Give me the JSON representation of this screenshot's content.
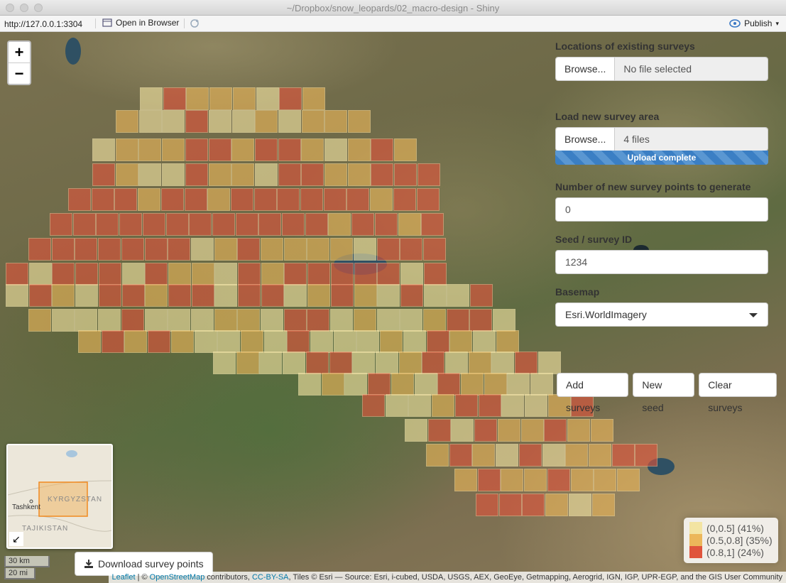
{
  "window": {
    "title": "~/Dropbox/snow_leopards/02_macro-design - Shiny"
  },
  "toolbar": {
    "url": "http://127.0.0.1:3304",
    "open_label": "Open in Browser",
    "publish_label": "Publish"
  },
  "map": {
    "zoom_in": "+",
    "zoom_out": "−",
    "minimap_labels": [
      "KYRGYZSTAN",
      "Tashkent",
      "TAJIKISTAN"
    ],
    "scale_km": "30 km",
    "scale_mi": "20 mi",
    "colors": {
      "low": "#f3e4a2",
      "mid": "#ecb75a",
      "high": "#e0543c"
    }
  },
  "panel": {
    "existing_label": "Locations of existing surveys",
    "existing_browse": "Browse...",
    "existing_file": "No file selected",
    "area_label": "Load new survey area",
    "area_browse": "Browse...",
    "area_file": "4 files",
    "upload_status": "Upload complete",
    "points_label": "Number of new survey points to generate",
    "points_value": "0",
    "seed_label": "Seed / survey ID",
    "seed_value": "1234",
    "basemap_label": "Basemap",
    "basemap_value": "Esri.WorldImagery",
    "add_button": "Add surveys",
    "new_seed_button": "New seed",
    "clear_button": "Clear surveys"
  },
  "download_button": "Download survey points",
  "legend": [
    {
      "label": "(0,0.5] (41%)",
      "color": "#f3e4a2"
    },
    {
      "label": "(0.5,0.8] (35%)",
      "color": "#ecb75a"
    },
    {
      "label": "(0.8,1] (24%)",
      "color": "#e0543c"
    }
  ],
  "attribution": {
    "leaflet": "Leaflet",
    "osm": "OpenStreetMap",
    "ccbysa": "CC-BY-SA",
    "rest": "Tiles © Esri — Source: Esri, i-cubed, USDA, USGS, AEX, GeoEye, Getmapping, Aerogrid, IGN, IGP, UPR-EGP, and the GIS User Community"
  }
}
